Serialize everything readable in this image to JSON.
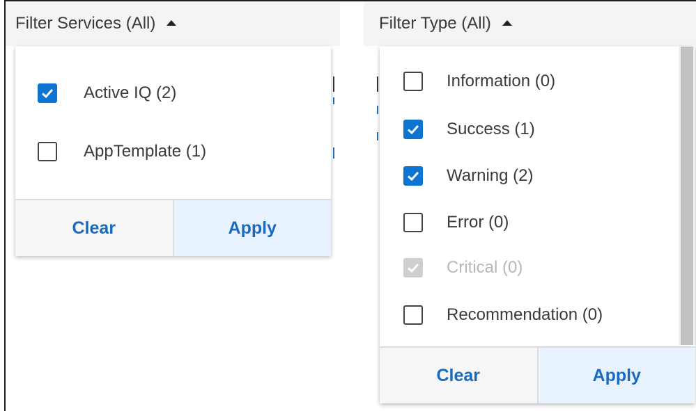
{
  "services_filter": {
    "header": "Filter Services (All)",
    "options": [
      {
        "label": "Active IQ (2)",
        "checked": true
      },
      {
        "label": "AppTemplate (1)",
        "checked": false
      }
    ],
    "clear_label": "Clear",
    "apply_label": "Apply"
  },
  "type_filter": {
    "header": "Filter Type (All)",
    "options": [
      {
        "label": "Information (0)",
        "checked": false,
        "disabled": false
      },
      {
        "label": "Success (1)",
        "checked": true,
        "disabled": false
      },
      {
        "label": "Warning (2)",
        "checked": true,
        "disabled": false
      },
      {
        "label": "Error (0)",
        "checked": false,
        "disabled": false
      },
      {
        "label": "Critical (0)",
        "checked": true,
        "disabled": true
      },
      {
        "label": "Recommendation (0)",
        "checked": false,
        "disabled": false
      }
    ],
    "clear_label": "Clear",
    "apply_label": "Apply"
  },
  "colors": {
    "accent": "#0e74d1",
    "link": "#1a6bbf",
    "apply_bg": "#e9f3ff",
    "disabled": "#cfcfcf"
  }
}
